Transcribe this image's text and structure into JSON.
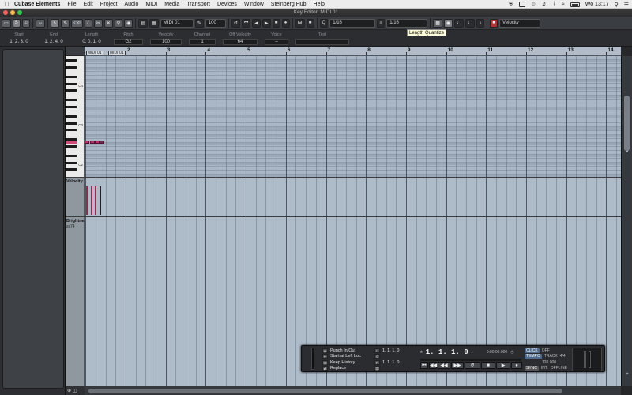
{
  "menubar": {
    "app_name": "Cubase Elements",
    "items": [
      "File",
      "Edit",
      "Project",
      "Audio",
      "MIDI",
      "Media",
      "Transport",
      "Devices",
      "Window",
      "Steinberg Hub",
      "Help"
    ],
    "clock": "Wo 13:17"
  },
  "window": {
    "title": "Key Editor: MIDI 01"
  },
  "toolbar": {
    "part_name": "MIDI 01",
    "zoom_value": "100",
    "quantize": "1/16",
    "length_quantize": "1/16",
    "controller_lane": "Velocity"
  },
  "tooltip": "Length Quantize",
  "infoline": {
    "columns": [
      {
        "label": "Start",
        "value": "1. 2. 3.  0"
      },
      {
        "label": "End",
        "value": "1. 2. 4.  0"
      },
      {
        "label": "Length",
        "value": "0. 0. 1.  0"
      },
      {
        "label": "Pitch",
        "value": "G2"
      },
      {
        "label": "Velocity",
        "value": "100"
      },
      {
        "label": "Channel",
        "value": "1"
      },
      {
        "label": "Off Velocity",
        "value": "64"
      },
      {
        "label": "Voice",
        "value": "–"
      },
      {
        "label": "Text",
        "value": ""
      }
    ]
  },
  "ruler": {
    "bar_numbers": [
      "2",
      "3",
      "4",
      "5",
      "6",
      "7",
      "8",
      "9",
      "10",
      "11",
      "12",
      "13",
      "14"
    ],
    "part_label_1": "MIDI 01",
    "part_label_2": "MIDI 01"
  },
  "keyboard": {
    "labels": [
      "C4",
      "C3",
      "C2"
    ]
  },
  "lanes": {
    "velocity_title": "Velocity",
    "brightness_title": "Brightnes",
    "brightness_sub": "ss74"
  },
  "transport": {
    "punch_in_out": "Punch In/Out",
    "start_at_left_loc": "Start at Left Loc",
    "keep_history": "Keep History",
    "replace": "Replace",
    "left_locator": "1.  1.  1.    0",
    "right_locator": "1.  1.  1.    0",
    "position_musical": "1.  1.  1.    0",
    "position_time": "0:00:00.000",
    "click_label": "CLICK",
    "click_state": "OFF",
    "tempo_label": "TEMPO",
    "tempo_mode": "TRACK",
    "signature": "4/4",
    "tempo_value": "120.000",
    "sync_label": "SYNC",
    "sync_mode": "INT.",
    "sync_state": "OFFLINE"
  }
}
